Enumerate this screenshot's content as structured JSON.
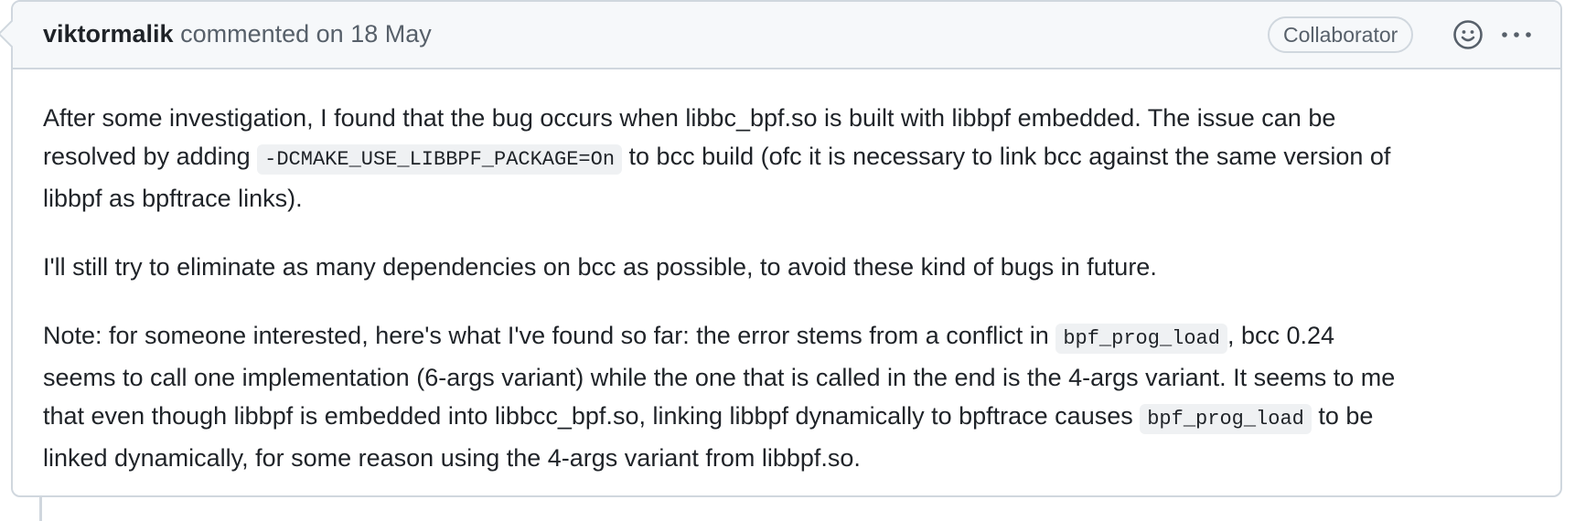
{
  "comment": {
    "author": "viktormalik",
    "action": "commented on 18 May",
    "role_badge": "Collaborator",
    "icons": [
      "smiley-icon",
      "kebab-horizontal-icon"
    ],
    "paragraphs": [
      {
        "lines": [
          {
            "pre": "After some investigation, I found that the bug occurs when libbc_bpf.so is built with libbpf embedded. The issue can be",
            "code": "",
            "post": ""
          },
          {
            "pre": "resolved by adding ",
            "code": "-DCMAKE_USE_LIBBPF_PACKAGE=On",
            "post": " to bcc build (ofc it is necessary to link bcc against the same version of"
          },
          {
            "pre": "libbpf as bpftrace links).",
            "code": "",
            "post": ""
          }
        ]
      },
      {
        "lines": [
          {
            "pre": "I'll still try to eliminate as many dependencies on bcc as possible, to avoid these kind of bugs in future.",
            "code": "",
            "post": ""
          }
        ]
      },
      {
        "lines": [
          {
            "pre": "Note: for someone interested, here's what I've found so far: the error stems from a conflict in ",
            "code": "bpf_prog_load",
            "post": ", bcc 0.24"
          },
          {
            "pre": "seems to call one implementation (6-args variant) while the one that is called in the end is the 4-args variant. It seems to me",
            "code": "",
            "post": ""
          },
          {
            "pre": "that even though libbpf is embedded into libbcc_bpf.so, linking libbpf dynamically to bpftrace causes ",
            "code": "bpf_prog_load",
            "post": " to be"
          },
          {
            "pre": "linked dynamically, for some reason using the 4-args variant from libbpf.so.",
            "code": "",
            "post": ""
          }
        ]
      }
    ]
  }
}
